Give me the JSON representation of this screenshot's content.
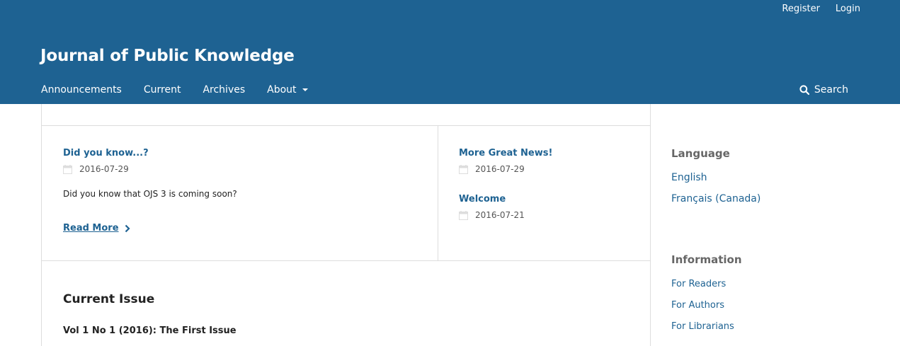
{
  "header": {
    "user_nav": [
      "Register",
      "Login"
    ],
    "site_title": "Journal of Public Knowledge",
    "nav": {
      "announcements": "Announcements",
      "current": "Current",
      "archives": "Archives",
      "about": "About"
    },
    "search_label": "Search"
  },
  "announcements": {
    "featured": {
      "title": "Did you know...?",
      "date": "2016-07-29",
      "summary": "Did you know that OJS 3 is coming soon?",
      "read_more": "Read More"
    },
    "others": [
      {
        "title": "More Great News!",
        "date": "2016-07-29"
      },
      {
        "title": "Welcome",
        "date": "2016-07-21"
      }
    ]
  },
  "current_issue": {
    "heading": "Current Issue",
    "title": "Vol 1 No 1 (2016): The First Issue"
  },
  "sidebar": {
    "language": {
      "heading": "Language",
      "items": [
        "English",
        "Français (Canada)"
      ]
    },
    "information": {
      "heading": "Information",
      "items": [
        "For Readers",
        "For Authors",
        "For Librarians"
      ]
    }
  },
  "icons": {
    "calendar": "calendar-icon",
    "search": "search-icon",
    "chevron": "chevron-right-icon",
    "caret": "caret-down-icon"
  },
  "colors": {
    "brand": "#1e6292",
    "link": "#1e6292",
    "sidebar_heading": "#666666"
  }
}
